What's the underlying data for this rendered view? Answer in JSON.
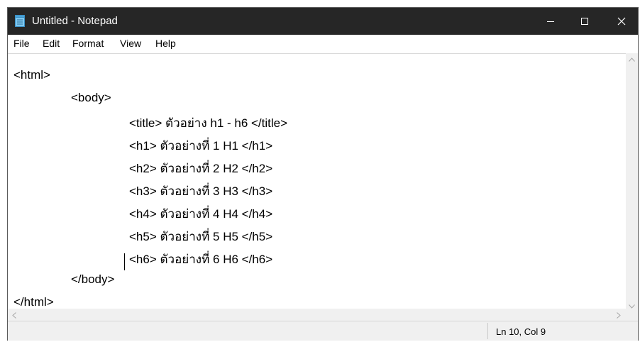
{
  "window": {
    "title": "Untitled - Notepad",
    "icon": "notepad-icon",
    "controls": [
      "minimize-icon",
      "maximize-icon",
      "close-icon"
    ]
  },
  "menu": {
    "items": [
      "File",
      "Edit",
      "Format",
      "View",
      "Help"
    ]
  },
  "editor": {
    "lines": [
      "<html>",
      "<body>",
      "<title> ตัวอย่าง h1 - h6 </title>",
      "<h1> ตัวอย่างที่ 1 H1 </h1>",
      "<h2> ตัวอย่างที่ 2 H2 </h2>",
      "<h3> ตัวอย่างที่ 3 H3 </h3>",
      "<h4> ตัวอย่างที่ 4 H4 </h4>",
      "<h5> ตัวอย่างที่ 5 H5 </h5>",
      "<h6> ตัวอย่างที่ 6 H6 </h6>",
      "</body>",
      "</html>"
    ]
  },
  "statusbar": {
    "position": "Ln 10, Col 9"
  },
  "colors": {
    "titlebar": "#262626",
    "statusbar": "#f0f0f0"
  }
}
